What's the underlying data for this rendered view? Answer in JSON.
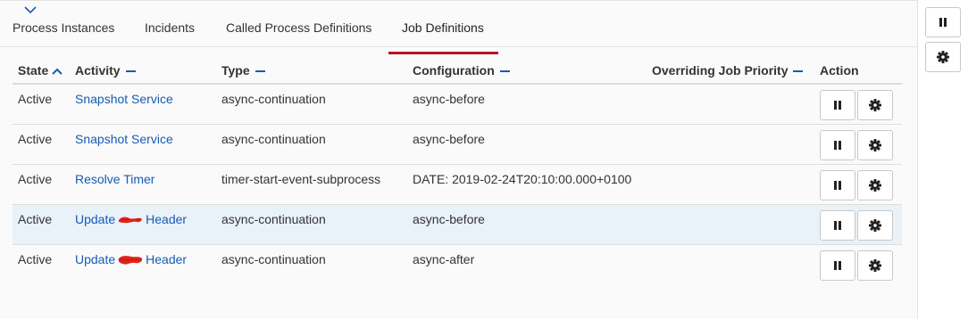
{
  "tabs": [
    {
      "label": "Process Instances"
    },
    {
      "label": "Incidents"
    },
    {
      "label": "Called Process Definitions"
    },
    {
      "label": "Job Definitions",
      "active": true
    }
  ],
  "table": {
    "headers": {
      "state": "State",
      "activity": "Activity",
      "type": "Type",
      "configuration": "Configuration",
      "priority": "Overriding Job Priority",
      "action": "Action"
    },
    "rows": [
      {
        "state": "Active",
        "activity": "Snapshot Service",
        "type": "async-continuation",
        "configuration": "async-before",
        "priority": ""
      },
      {
        "state": "Active",
        "activity": "Snapshot Service",
        "type": "async-continuation",
        "configuration": "async-before",
        "priority": ""
      },
      {
        "state": "Active",
        "activity": "Resolve Timer",
        "type": "timer-start-event-subprocess",
        "configuration": "DATE: 2019-02-24T20:10:00.000+0100",
        "priority": ""
      },
      {
        "state": "Active",
        "activity_prefix": "Update",
        "activity_suffix": "Header",
        "type": "async-continuation",
        "configuration": "async-before",
        "priority": "",
        "highlighted": true
      },
      {
        "state": "Active",
        "activity_prefix": "Update",
        "activity_suffix": "Header",
        "type": "async-continuation",
        "configuration": "async-after",
        "priority": ""
      }
    ]
  },
  "icons": {
    "collapse": "chevron-down-icon",
    "suspend": "pause-icon",
    "settings": "gear-icon",
    "sort_asc": "caret-up-icon",
    "sort_none": "minus-icon"
  },
  "colors": {
    "link": "#155cb5",
    "active_tab_underline": "#b5152b",
    "row_highlight": "#e9f1f9",
    "redaction": "#e0241b"
  }
}
